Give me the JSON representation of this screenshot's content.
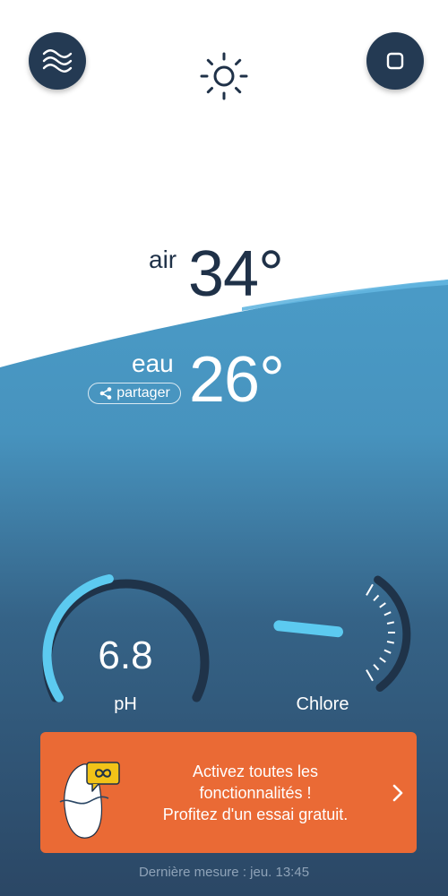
{
  "header": {
    "menu_icon": "waves-icon",
    "weather_icon": "sun-icon",
    "device_icon": "device-icon"
  },
  "air": {
    "label": "air",
    "value": "34°"
  },
  "eau": {
    "label": "eau",
    "value": "26°",
    "share_label": "partager"
  },
  "ph": {
    "value": "6.8",
    "label": "pH",
    "level": 0.45
  },
  "chlore": {
    "label": "Chlore",
    "level": 0.55
  },
  "promo": {
    "line1": "Activez toutes les",
    "line2": "fonctionnalités !",
    "line3": "Profitez d'un essai gratuit."
  },
  "footer": {
    "last_measure": "Dernière mesure : jeu. 13:45"
  },
  "colors": {
    "navy": "#243a53",
    "sky": "#5ccaf0",
    "promo": "#ea6a35",
    "water_top": "#4a9cc8",
    "water_bottom": "#2c4c6c"
  }
}
